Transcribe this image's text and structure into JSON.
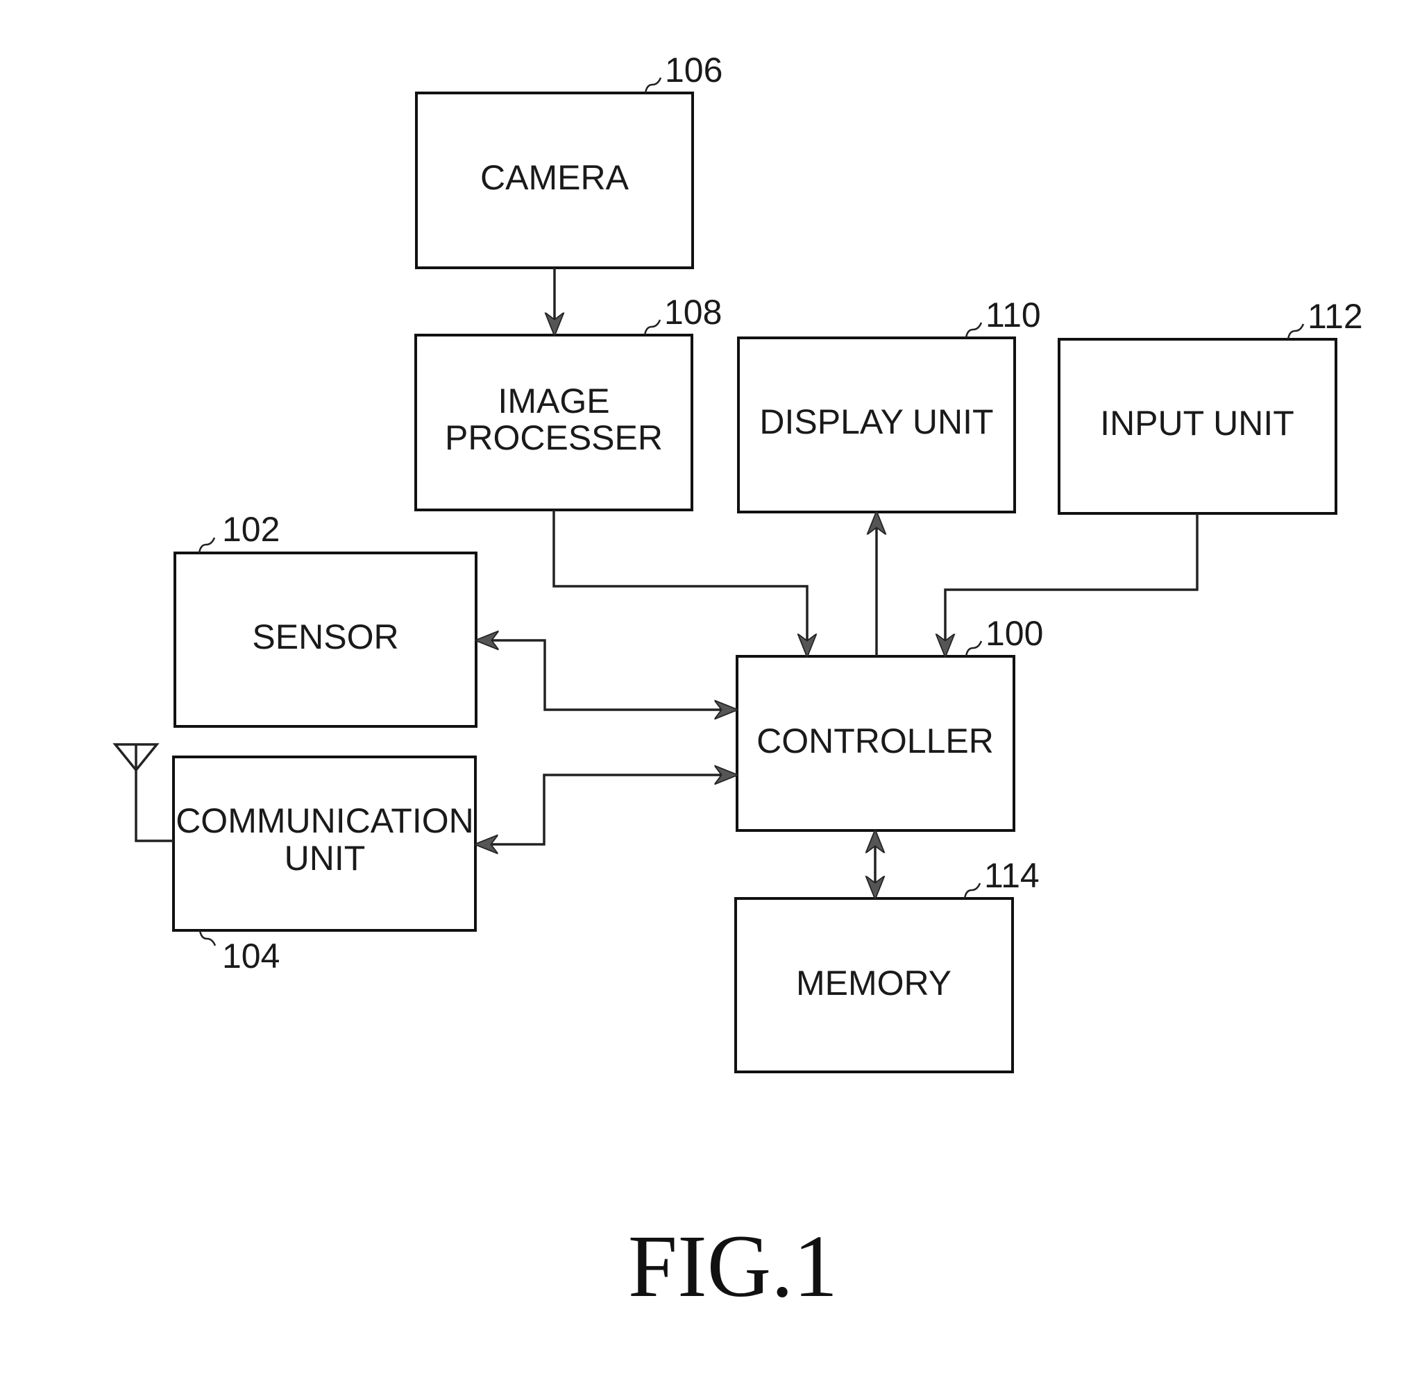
{
  "figure": {
    "caption": "FIG.1",
    "blocks": [
      {
        "id": "camera",
        "ref": "106",
        "lines": [
          "CAMERA"
        ]
      },
      {
        "id": "image_processor",
        "ref": "108",
        "lines": [
          "IMAGE",
          "PROCESSER"
        ]
      },
      {
        "id": "display_unit",
        "ref": "110",
        "lines": [
          "DISPLAY UNIT"
        ]
      },
      {
        "id": "input_unit",
        "ref": "112",
        "lines": [
          "INPUT UNIT"
        ]
      },
      {
        "id": "sensor",
        "ref": "102",
        "lines": [
          "SENSOR"
        ]
      },
      {
        "id": "communication_unit",
        "ref": "104",
        "lines": [
          "COMMUNICATION",
          "UNIT"
        ]
      },
      {
        "id": "controller",
        "ref": "100",
        "lines": [
          "CONTROLLER"
        ]
      },
      {
        "id": "memory",
        "ref": "114",
        "lines": [
          "MEMORY"
        ]
      }
    ],
    "connections": [
      {
        "from": "camera",
        "to": "image_processor",
        "direction": "one-way"
      },
      {
        "from": "image_processor",
        "to": "controller",
        "direction": "one-way"
      },
      {
        "from": "controller",
        "to": "display_unit",
        "direction": "one-way"
      },
      {
        "from": "input_unit",
        "to": "controller",
        "direction": "one-way"
      },
      {
        "from": "controller",
        "to": "sensor",
        "direction": "two-way"
      },
      {
        "from": "controller",
        "to": "communication_unit",
        "direction": "two-way"
      },
      {
        "from": "controller",
        "to": "memory",
        "direction": "two-way"
      }
    ],
    "icons": [
      "antenna-icon"
    ]
  }
}
